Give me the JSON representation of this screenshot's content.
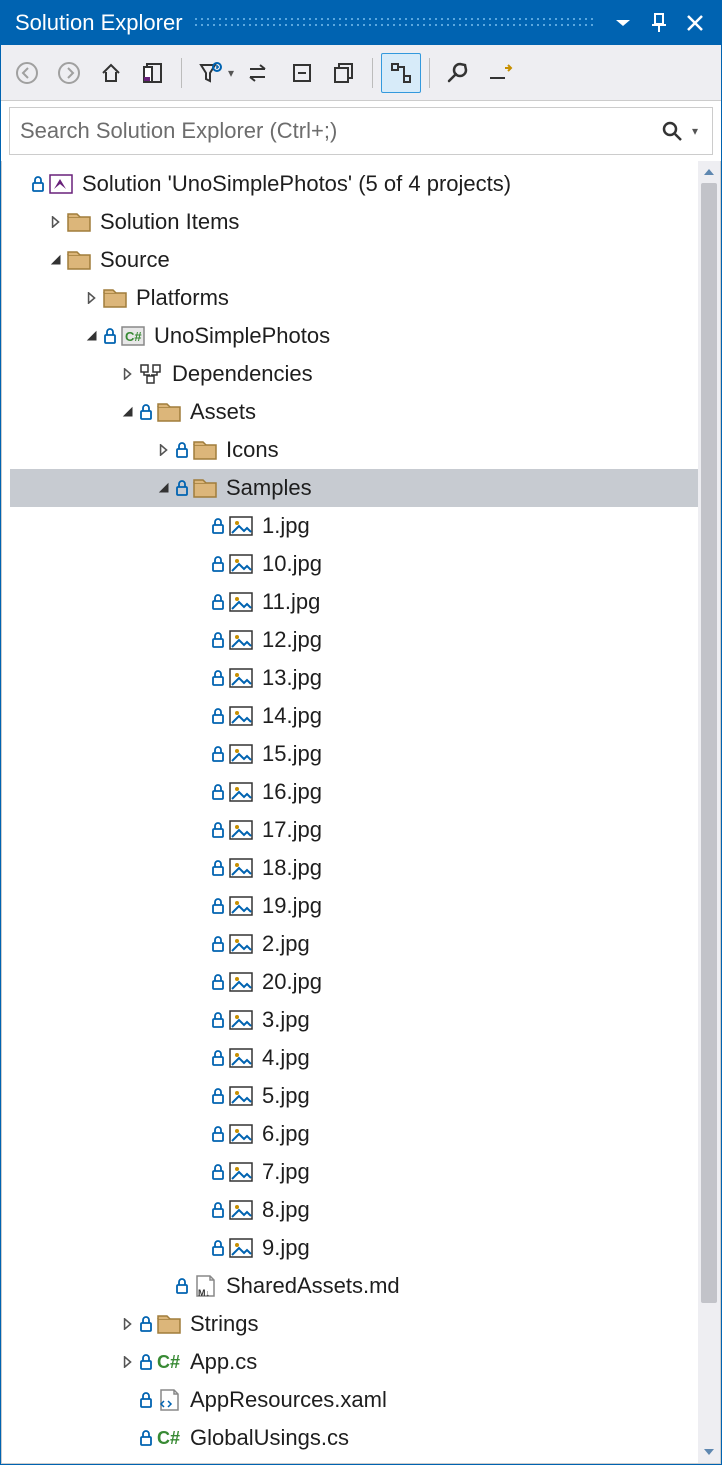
{
  "colors": {
    "accent": "#0063B1"
  },
  "title": "Solution Explorer",
  "search": {
    "placeholder": "Search Solution Explorer (Ctrl+;)"
  },
  "tree": [
    {
      "id": "sol",
      "depth": 0,
      "arrow": "none",
      "lock": true,
      "icon": "vs-solution",
      "label": "Solution 'UnoSimplePhotos' (5 of 4 projects)"
    },
    {
      "id": "solution-items",
      "depth": 1,
      "arrow": "right",
      "lock": false,
      "icon": "folder",
      "label": "Solution Items"
    },
    {
      "id": "source",
      "depth": 1,
      "arrow": "down",
      "lock": false,
      "icon": "folder",
      "label": "Source"
    },
    {
      "id": "platforms",
      "depth": 2,
      "arrow": "right",
      "lock": false,
      "icon": "folder",
      "label": "Platforms"
    },
    {
      "id": "project",
      "depth": 2,
      "arrow": "down",
      "lock": true,
      "icon": "csproj",
      "label": "UnoSimplePhotos"
    },
    {
      "id": "deps",
      "depth": 3,
      "arrow": "right",
      "lock": false,
      "icon": "deps",
      "label": "Dependencies"
    },
    {
      "id": "assets",
      "depth": 3,
      "arrow": "down",
      "lock": true,
      "icon": "folder",
      "label": "Assets"
    },
    {
      "id": "icons",
      "depth": 4,
      "arrow": "right",
      "lock": true,
      "icon": "folder",
      "label": "Icons"
    },
    {
      "id": "samples",
      "depth": 4,
      "arrow": "down",
      "lock": true,
      "icon": "folder",
      "label": "Samples",
      "selected": true
    },
    {
      "id": "s1",
      "depth": 5,
      "arrow": "none",
      "lock": true,
      "icon": "image",
      "label": "1.jpg"
    },
    {
      "id": "s10",
      "depth": 5,
      "arrow": "none",
      "lock": true,
      "icon": "image",
      "label": "10.jpg"
    },
    {
      "id": "s11",
      "depth": 5,
      "arrow": "none",
      "lock": true,
      "icon": "image",
      "label": "11.jpg"
    },
    {
      "id": "s12",
      "depth": 5,
      "arrow": "none",
      "lock": true,
      "icon": "image",
      "label": "12.jpg"
    },
    {
      "id": "s13",
      "depth": 5,
      "arrow": "none",
      "lock": true,
      "icon": "image",
      "label": "13.jpg"
    },
    {
      "id": "s14",
      "depth": 5,
      "arrow": "none",
      "lock": true,
      "icon": "image",
      "label": "14.jpg"
    },
    {
      "id": "s15",
      "depth": 5,
      "arrow": "none",
      "lock": true,
      "icon": "image",
      "label": "15.jpg"
    },
    {
      "id": "s16",
      "depth": 5,
      "arrow": "none",
      "lock": true,
      "icon": "image",
      "label": "16.jpg"
    },
    {
      "id": "s17",
      "depth": 5,
      "arrow": "none",
      "lock": true,
      "icon": "image",
      "label": "17.jpg"
    },
    {
      "id": "s18",
      "depth": 5,
      "arrow": "none",
      "lock": true,
      "icon": "image",
      "label": "18.jpg"
    },
    {
      "id": "s19",
      "depth": 5,
      "arrow": "none",
      "lock": true,
      "icon": "image",
      "label": "19.jpg"
    },
    {
      "id": "s2",
      "depth": 5,
      "arrow": "none",
      "lock": true,
      "icon": "image",
      "label": "2.jpg"
    },
    {
      "id": "s20",
      "depth": 5,
      "arrow": "none",
      "lock": true,
      "icon": "image",
      "label": "20.jpg"
    },
    {
      "id": "s3",
      "depth": 5,
      "arrow": "none",
      "lock": true,
      "icon": "image",
      "label": "3.jpg"
    },
    {
      "id": "s4",
      "depth": 5,
      "arrow": "none",
      "lock": true,
      "icon": "image",
      "label": "4.jpg"
    },
    {
      "id": "s5",
      "depth": 5,
      "arrow": "none",
      "lock": true,
      "icon": "image",
      "label": "5.jpg"
    },
    {
      "id": "s6",
      "depth": 5,
      "arrow": "none",
      "lock": true,
      "icon": "image",
      "label": "6.jpg"
    },
    {
      "id": "s7",
      "depth": 5,
      "arrow": "none",
      "lock": true,
      "icon": "image",
      "label": "7.jpg"
    },
    {
      "id": "s8",
      "depth": 5,
      "arrow": "none",
      "lock": true,
      "icon": "image",
      "label": "8.jpg"
    },
    {
      "id": "s9",
      "depth": 5,
      "arrow": "none",
      "lock": true,
      "icon": "image",
      "label": "9.jpg"
    },
    {
      "id": "shared",
      "depth": 4,
      "arrow": "none",
      "lock": true,
      "icon": "md",
      "label": "SharedAssets.md"
    },
    {
      "id": "strings",
      "depth": 3,
      "arrow": "right",
      "lock": true,
      "icon": "folder",
      "label": "Strings"
    },
    {
      "id": "app",
      "depth": 3,
      "arrow": "right",
      "lock": true,
      "icon": "cs",
      "label": "App.cs"
    },
    {
      "id": "appres",
      "depth": 3,
      "arrow": "none",
      "lock": true,
      "icon": "xaml",
      "label": "AppResources.xaml"
    },
    {
      "id": "global",
      "depth": 3,
      "arrow": "none",
      "lock": true,
      "icon": "cs",
      "label": "GlobalUsings.cs"
    }
  ]
}
